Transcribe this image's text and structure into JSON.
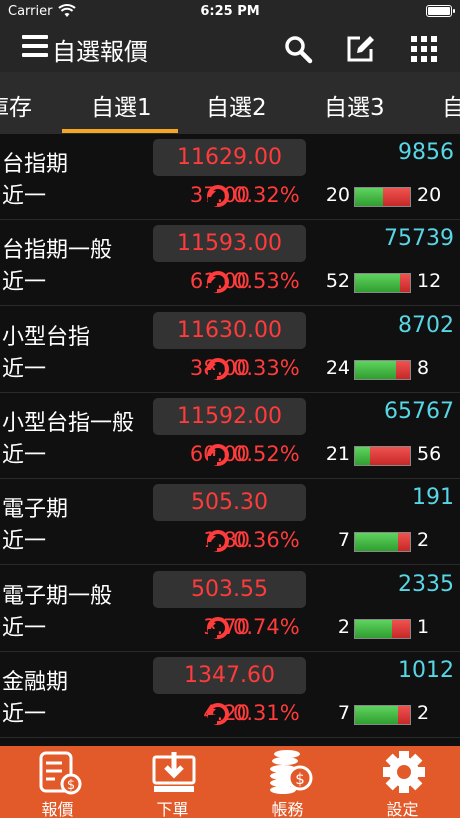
{
  "status": {
    "carrier": "Carrier",
    "time": "6:25 PM"
  },
  "header": {
    "title": "自選報價",
    "search_icon": "search-icon",
    "edit_icon": "edit-icon",
    "grid_icon": "grid-icon"
  },
  "tabs": [
    {
      "label": "庫存"
    },
    {
      "label": "自選1",
      "active": true
    },
    {
      "label": "自選2"
    },
    {
      "label": "自選3"
    },
    {
      "label": "自"
    }
  ],
  "quotes": [
    {
      "name": "台指期",
      "month": "近一",
      "price": "11629.00",
      "volume": "9856",
      "change": "37.00",
      "percent": "0.32%",
      "bid": "20",
      "ask": "20",
      "bid_ratio": 0.5
    },
    {
      "name": "台指期一般",
      "month": "近一",
      "price": "11593.00",
      "volume": "75739",
      "change": "61.00",
      "percent": "0.53%",
      "bid": "52",
      "ask": "12",
      "bid_ratio": 0.81
    },
    {
      "name": "小型台指",
      "month": "近一",
      "price": "11630.00",
      "volume": "8702",
      "change": "38.00",
      "percent": "0.33%",
      "bid": "24",
      "ask": "8",
      "bid_ratio": 0.75
    },
    {
      "name": "小型台指一般",
      "month": "近一",
      "price": "11592.00",
      "volume": "65767",
      "change": "60.00",
      "percent": "0.52%",
      "bid": "21",
      "ask": "56",
      "bid_ratio": 0.27
    },
    {
      "name": "電子期",
      "month": "近一",
      "price": "505.30",
      "volume": "191",
      "change": "1.80",
      "percent": "0.36%",
      "bid": "7",
      "ask": "2",
      "bid_ratio": 0.78
    },
    {
      "name": "電子期一般",
      "month": "近一",
      "price": "503.55",
      "volume": "2335",
      "change": "3.70",
      "percent": "0.74%",
      "bid": "2",
      "ask": "1",
      "bid_ratio": 0.67
    },
    {
      "name": "金融期",
      "month": "近一",
      "price": "1347.60",
      "volume": "1012",
      "change": "4.20",
      "percent": "0.31%",
      "bid": "7",
      "ask": "2",
      "bid_ratio": 0.78
    }
  ],
  "bottom_nav": [
    {
      "label": "報價",
      "icon": "quote-icon"
    },
    {
      "label": "下單",
      "icon": "order-icon"
    },
    {
      "label": "帳務",
      "icon": "account-icon"
    },
    {
      "label": "設定",
      "icon": "settings-icon"
    }
  ],
  "colors": {
    "up": "#ff3b3b",
    "volume": "#58d6e6",
    "accent": "#f5a623",
    "tabbar": "#e35a2a"
  }
}
